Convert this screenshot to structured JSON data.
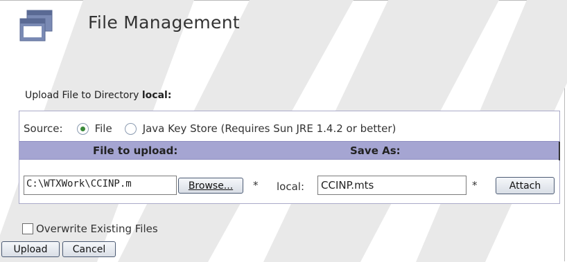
{
  "page": {
    "title": "File Management",
    "upload_heading_prefix": "Upload File to Directory",
    "upload_heading_dir": "local:"
  },
  "source": {
    "label": "Source:",
    "options": [
      {
        "label": "File",
        "selected": true
      },
      {
        "label": "Java Key Store (Requires Sun JRE 1.4.2 or better)",
        "selected": false
      }
    ]
  },
  "table": {
    "headers": {
      "file_to_upload": "File to upload:",
      "save_as": "Save As:"
    }
  },
  "row": {
    "file_path": "C:\\WTXWork\\CCINP.m",
    "browse_label": "Browse...",
    "required_marker": "*",
    "local_label": "local:",
    "save_as_value": "CCINP.mts",
    "attach_label": "Attach"
  },
  "options": {
    "overwrite_label": "Overwrite Existing Files",
    "overwrite_checked": false
  },
  "actions": {
    "upload_label": "Upload",
    "cancel_label": "Cancel"
  },
  "colors": {
    "header_bar": "#a5a5d2",
    "radio_selected": "#3b8a3b"
  }
}
